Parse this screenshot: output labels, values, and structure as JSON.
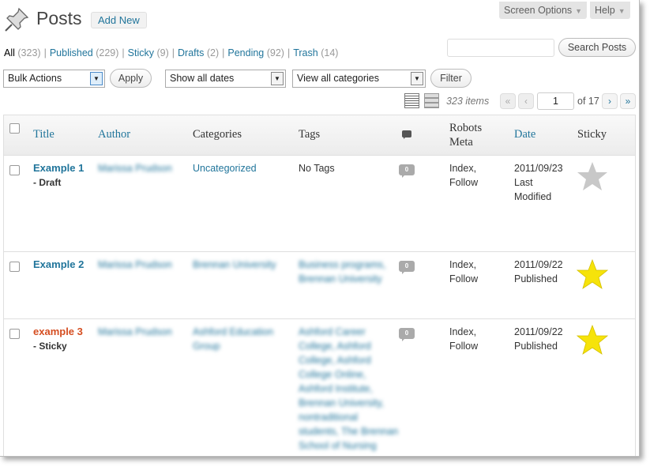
{
  "header": {
    "title": "Posts",
    "add_new": "Add New",
    "screen_options": "Screen Options",
    "help": "Help"
  },
  "filters": {
    "all": {
      "label": "All",
      "count": "(323)"
    },
    "published": {
      "label": "Published",
      "count": "(229)"
    },
    "sticky": {
      "label": "Sticky",
      "count": "(9)"
    },
    "drafts": {
      "label": "Drafts",
      "count": "(2)"
    },
    "pending": {
      "label": "Pending",
      "count": "(92)"
    },
    "trash": {
      "label": "Trash",
      "count": "(14)"
    },
    "separator": "|"
  },
  "search": {
    "placeholder": "",
    "button": "Search Posts"
  },
  "actions": {
    "bulk": "Bulk Actions",
    "apply": "Apply",
    "dates": "Show all dates",
    "categories": "View all categories",
    "filter": "Filter",
    "dropdown_glyph": "▼"
  },
  "pagination": {
    "items": "323 items",
    "first": "«",
    "prev": "‹",
    "current": "1",
    "of": "of 17",
    "next": "›",
    "last": "»"
  },
  "columns": {
    "title": "Title",
    "author": "Author",
    "categories": "Categories",
    "tags": "Tags",
    "robots_line1": "Robots",
    "robots_line2": "Meta",
    "date": "Date",
    "sticky": "Sticky"
  },
  "rows": [
    {
      "title": "Example 1",
      "state": "- Draft",
      "author": "Marissa Prudson",
      "categories": "Uncategorized",
      "tags": "No Tags",
      "comments": "0",
      "robots1": "Index,",
      "robots2": "Follow",
      "date": "2011/09/23",
      "status1": "Last",
      "status2": "Modified",
      "sticky": false
    },
    {
      "title": "Example 2",
      "state": "",
      "author": "Marissa Prudson",
      "categories": "Brennan University",
      "tags1": "Business programs,",
      "tags2": "Brennan University",
      "comments": "0",
      "robots1": "Index,",
      "robots2": "Follow",
      "date": "2011/09/22",
      "status1": "Published",
      "sticky": true
    },
    {
      "title": "example 3",
      "state": "- Sticky",
      "author": "Marissa Prudson",
      "cat1": "Ashford Education",
      "cat2": "Group",
      "tags_lines": [
        "Ashford Career",
        "College, Ashford",
        "College, Ashford",
        "College Online,",
        "Ashford Institute,",
        "Brennan University,",
        "nontraditional",
        "students, The Brennan",
        "School of Nursing"
      ],
      "comments": "0",
      "robots1": "Index,",
      "robots2": "Follow",
      "date": "2011/09/22",
      "status1": "Published",
      "sticky": true
    }
  ],
  "colors": {
    "link": "#21759b",
    "sticky_title": "#d54e21",
    "star_on": "#f6e30a",
    "star_off": "#c8c8c8"
  }
}
